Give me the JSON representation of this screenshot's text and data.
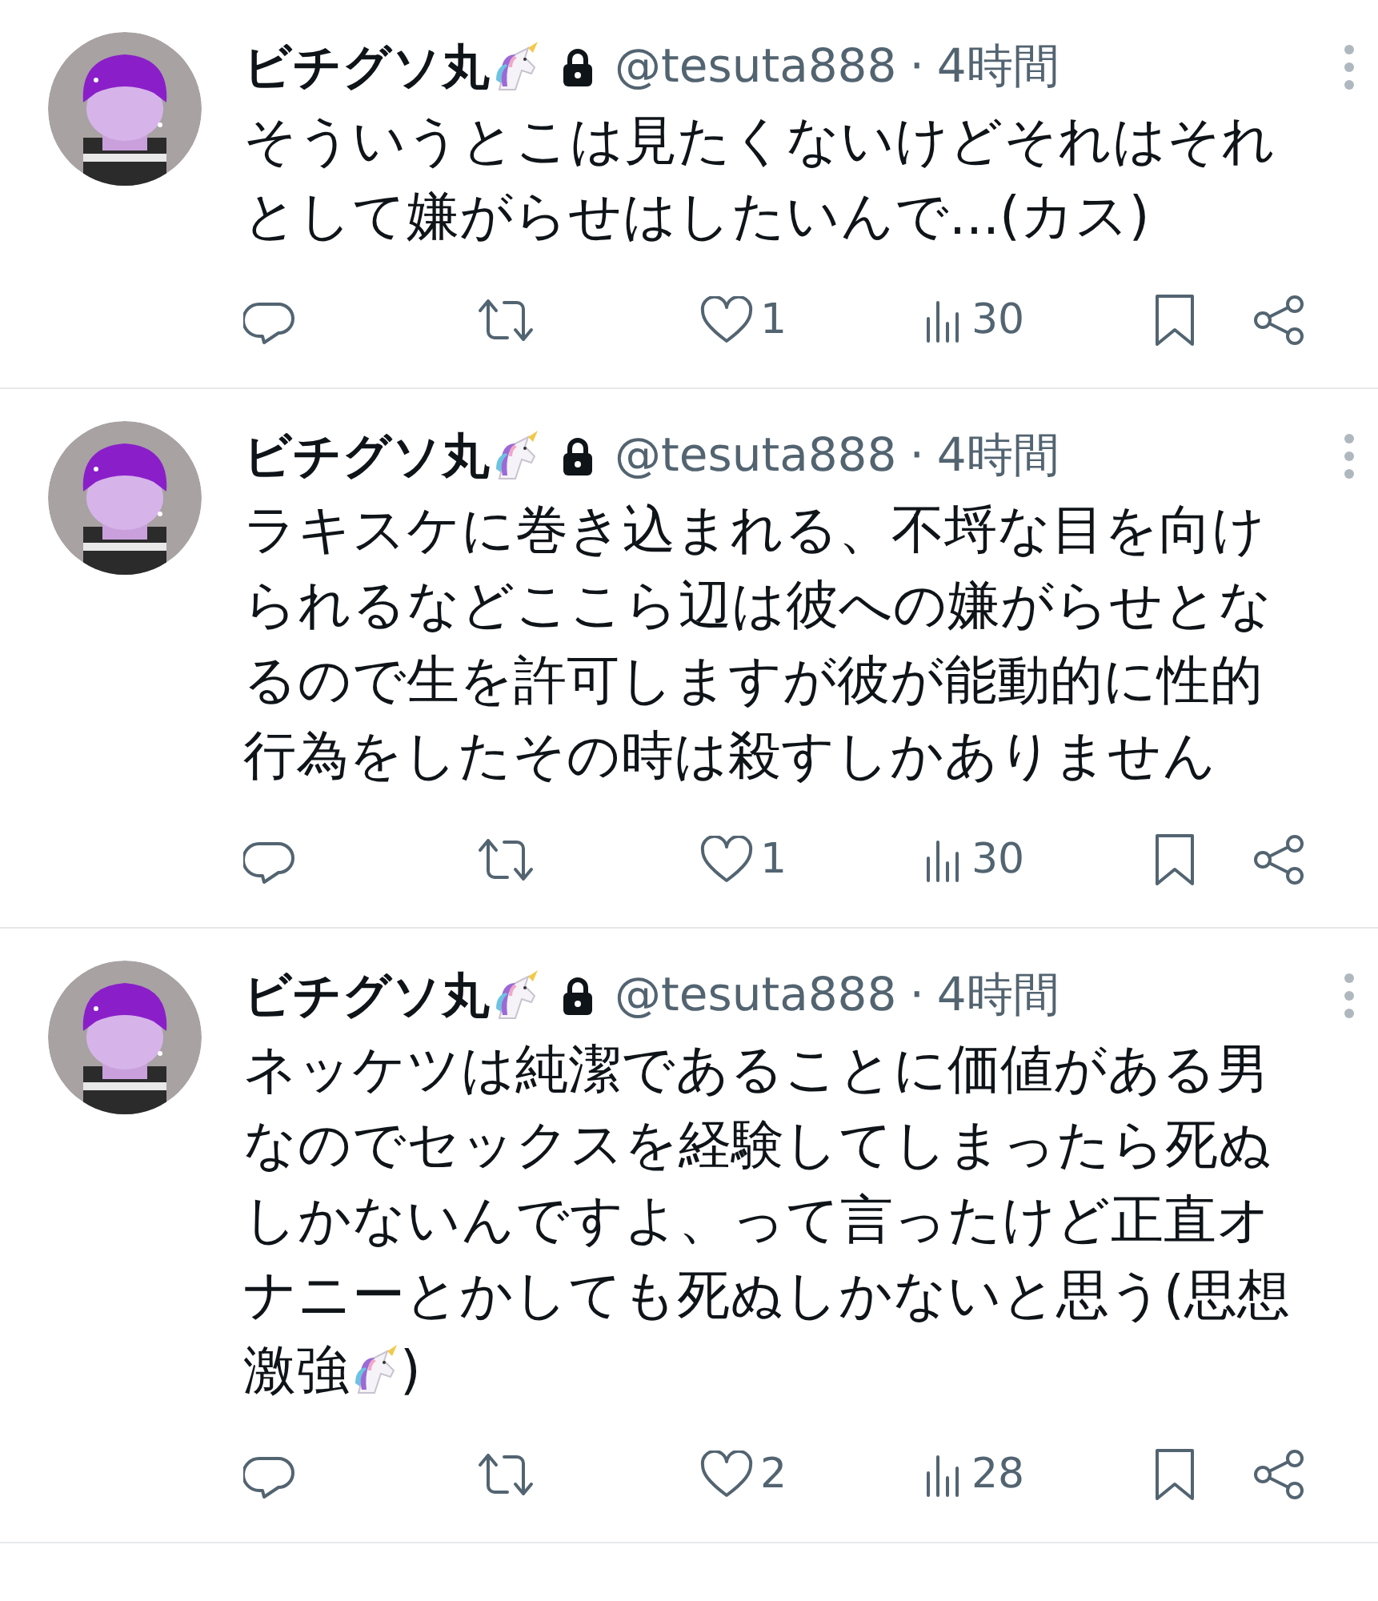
{
  "tweets": [
    {
      "name": "ビチグソ丸",
      "handle": "@tesuta888",
      "separator": "·",
      "time": "4時間",
      "body": "そういうとこは見たくないけどそれはそれとして嫌がらせはしたいんで...(カス)",
      "likes": "1",
      "views": "30"
    },
    {
      "name": "ビチグソ丸",
      "handle": "@tesuta888",
      "separator": "·",
      "time": "4時間",
      "body": "ラキスケに巻き込まれる、不埒な目を向けられるなどここら辺は彼への嫌がらせとなるので生を許可しますが彼が能動的に性的行為をしたその時は殺すしかありません",
      "likes": "1",
      "views": "30"
    },
    {
      "name": "ビチグソ丸",
      "handle": "@tesuta888",
      "separator": "·",
      "time": "4時間",
      "body": "ネッケツは純潔であることに価値がある男なのでセックスを経験してしまったら死ぬしかないんですよ、って言ったけど正直オナニーとかしても死ぬしかないと思う(思想",
      "body_tail": "激強",
      "body_after": ")",
      "likes": "2",
      "views": "28"
    }
  ]
}
